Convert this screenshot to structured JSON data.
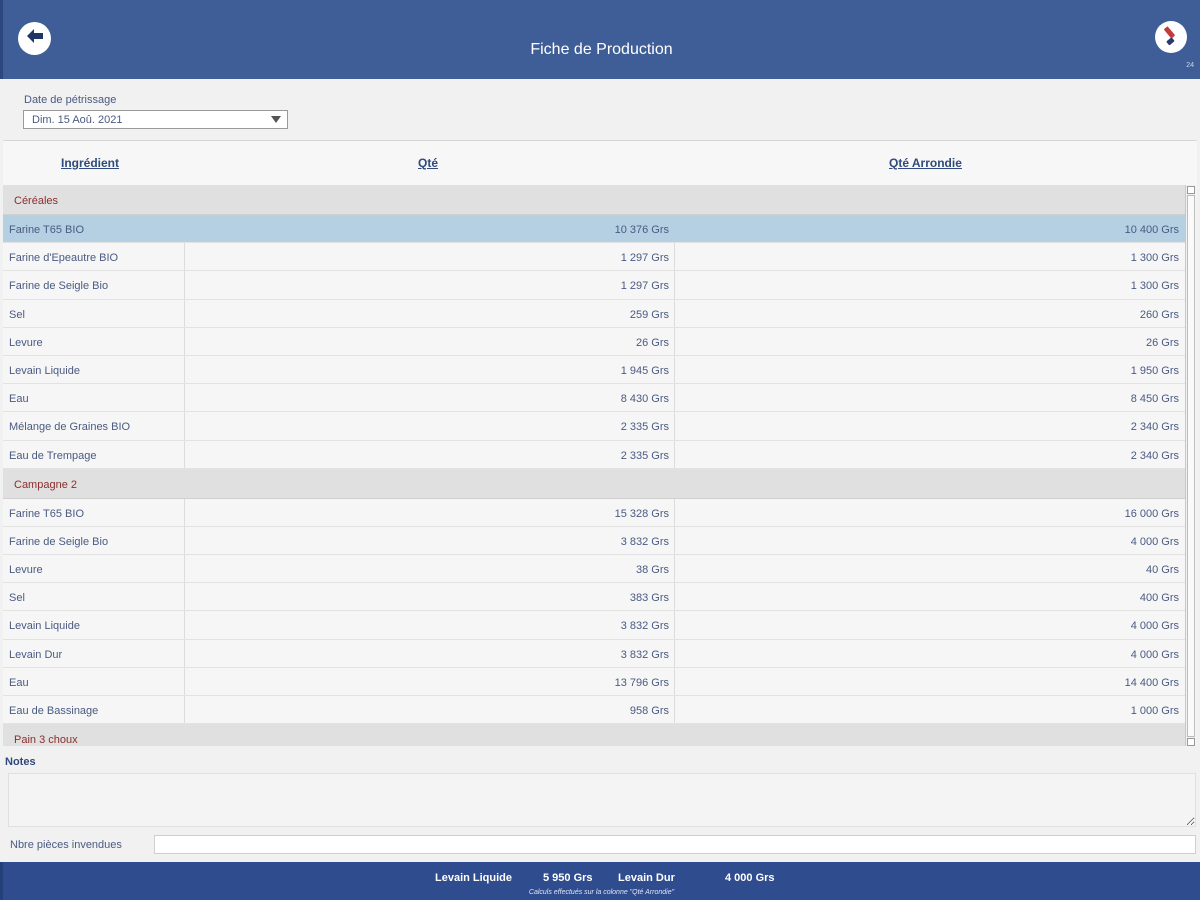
{
  "header": {
    "title": "Fiche de Production",
    "version": "24",
    "back_icon": "back-arrow-icon",
    "brush_icon": "brush-icon"
  },
  "date_filter": {
    "label": "Date de pétrissage",
    "value": "Dim. 15 Aoû. 2021"
  },
  "table": {
    "columns": [
      "Ingrédient",
      "Qté",
      "Qté Arrondie"
    ],
    "groups": [
      {
        "name": "Céréales",
        "rows": [
          {
            "ingredient": "Farine T65 BIO",
            "qty": "10 376 Grs",
            "rounded": "10 400 Grs",
            "selected": true
          },
          {
            "ingredient": "Farine d'Epeautre BIO",
            "qty": "1 297 Grs",
            "rounded": "1 300 Grs"
          },
          {
            "ingredient": "Farine de Seigle Bio",
            "qty": "1 297 Grs",
            "rounded": "1 300 Grs"
          },
          {
            "ingredient": "Sel",
            "qty": "259 Grs",
            "rounded": "260 Grs"
          },
          {
            "ingredient": "Levure",
            "qty": "26 Grs",
            "rounded": "26 Grs"
          },
          {
            "ingredient": "Levain Liquide",
            "qty": "1 945 Grs",
            "rounded": "1 950 Grs"
          },
          {
            "ingredient": "Eau",
            "qty": "8 430 Grs",
            "rounded": "8 450 Grs"
          },
          {
            "ingredient": "Mélange de Graines BIO",
            "qty": "2 335 Grs",
            "rounded": "2 340 Grs"
          },
          {
            "ingredient": "Eau de Trempage",
            "qty": "2 335 Grs",
            "rounded": "2 340 Grs"
          }
        ]
      },
      {
        "name": "Campagne 2",
        "rows": [
          {
            "ingredient": "Farine T65 BIO",
            "qty": "15 328 Grs",
            "rounded": "16 000 Grs"
          },
          {
            "ingredient": "Farine de Seigle Bio",
            "qty": "3 832 Grs",
            "rounded": "4 000 Grs"
          },
          {
            "ingredient": "Levure",
            "qty": "38 Grs",
            "rounded": "40 Grs"
          },
          {
            "ingredient": "Sel",
            "qty": "383 Grs",
            "rounded": "400 Grs"
          },
          {
            "ingredient": "Levain Liquide",
            "qty": "3 832 Grs",
            "rounded": "4 000 Grs"
          },
          {
            "ingredient": "Levain Dur",
            "qty": "3 832 Grs",
            "rounded": "4 000 Grs"
          },
          {
            "ingredient": "Eau",
            "qty": "13 796 Grs",
            "rounded": "14 400 Grs"
          },
          {
            "ingredient": "Eau de Bassinage",
            "qty": "958 Grs",
            "rounded": "1 000 Grs"
          }
        ]
      },
      {
        "name": "Pain 3 choux",
        "rows": []
      }
    ]
  },
  "notes": {
    "label": "Notes",
    "value": ""
  },
  "unsold": {
    "label": "Nbre pièces invendues",
    "value": ""
  },
  "footer": {
    "levain_liquide_label": "Levain Liquide",
    "levain_liquide_value": "5 950 Grs",
    "levain_dur_label": "Levain Dur",
    "levain_dur_value": "4 000 Grs",
    "note": "Calculs effectués sur la colonne \"Qté Arrondie\""
  }
}
